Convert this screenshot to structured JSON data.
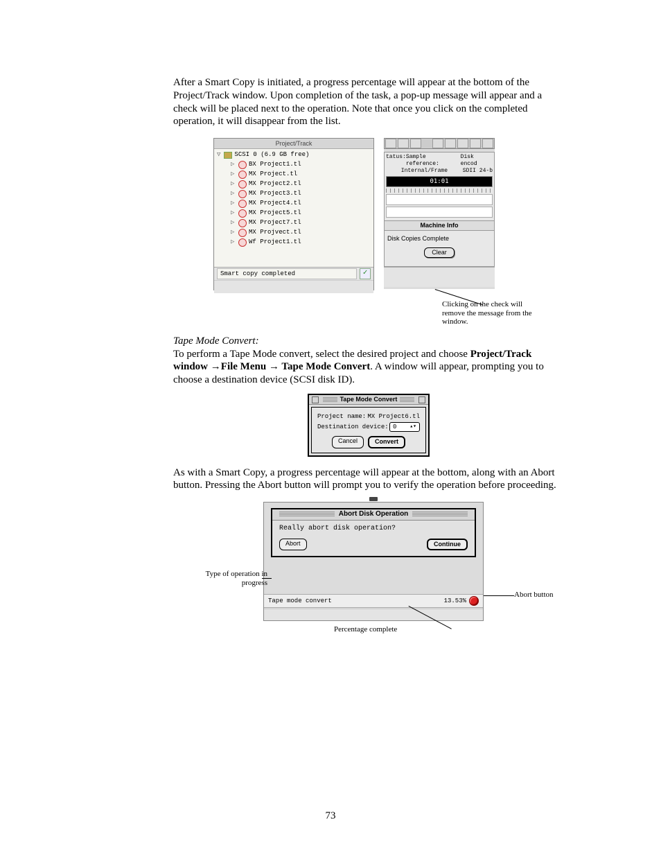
{
  "para1": "After a Smart Copy is initiated, a progress percentage will appear at the bottom of the Project/Track window. Upon completion of the task, a pop-up message will appear and a check will be placed next to the operation. Note that once you click on the completed operation, it will disappear from the list.",
  "fig1": {
    "window_title": "Project/Track",
    "root_label": "SCSI 0   (6.9 GB free)",
    "items": [
      "BX Project1.tl",
      "MX Project.tl",
      "MX Project2.tl",
      "MX Project3.tl",
      "MX Project4.tl",
      "MX Project5.tl",
      "MX Project7.tl",
      "MX Projvect.tl",
      "Wf Project1.tl"
    ],
    "status_text": "Smart copy completed",
    "right": {
      "hdr_status_label": "tatus:",
      "hdr_col1": "Sample reference:",
      "hdr_col2": "Disk encod",
      "hdr_val1": "Internal/Frame",
      "hdr_val2": "SDII 24-b",
      "timecode": "01:01",
      "group_title": "Machine Info",
      "group_msg": "Disk Copies Complete",
      "clear_btn": "Clear"
    },
    "callout": "Clicking on the check will remove the message from the window."
  },
  "heading2": "Tape Mode Convert:",
  "para2a": "To perform a Tape Mode convert, select the desired project and choose ",
  "para2b_bold1": "Project/Track window ",
  "para2b_bold2": "File Menu ",
  "para2b_bold3": " Tape Mode Convert",
  "para2c": ". A window will appear, prompting you to choose a destination device (SCSI disk ID).",
  "fig2": {
    "title": "Tape Mode Convert",
    "row1_label": "Project name:",
    "row1_value": "MX Project6.tl",
    "row2_label": "Destination device:",
    "row2_value": "0",
    "cancel": "Cancel",
    "convert": "Convert"
  },
  "para3": "As with a Smart Copy, a progress percentage will appear at the bottom, along with an Abort button. Pressing the Abort button will prompt you to verify the operation before proceeding.",
  "fig3": {
    "title": "Abort Disk Operation",
    "question": "Really abort disk operation?",
    "abort_btn": "Abort",
    "continue_btn": "Continue",
    "progress_label": "Tape mode convert",
    "progress_pct": "13.53%",
    "callout_type": "Type of operation in progress",
    "callout_abort": "Abort button",
    "callout_pct": "Percentage complete"
  },
  "page_number": "73"
}
